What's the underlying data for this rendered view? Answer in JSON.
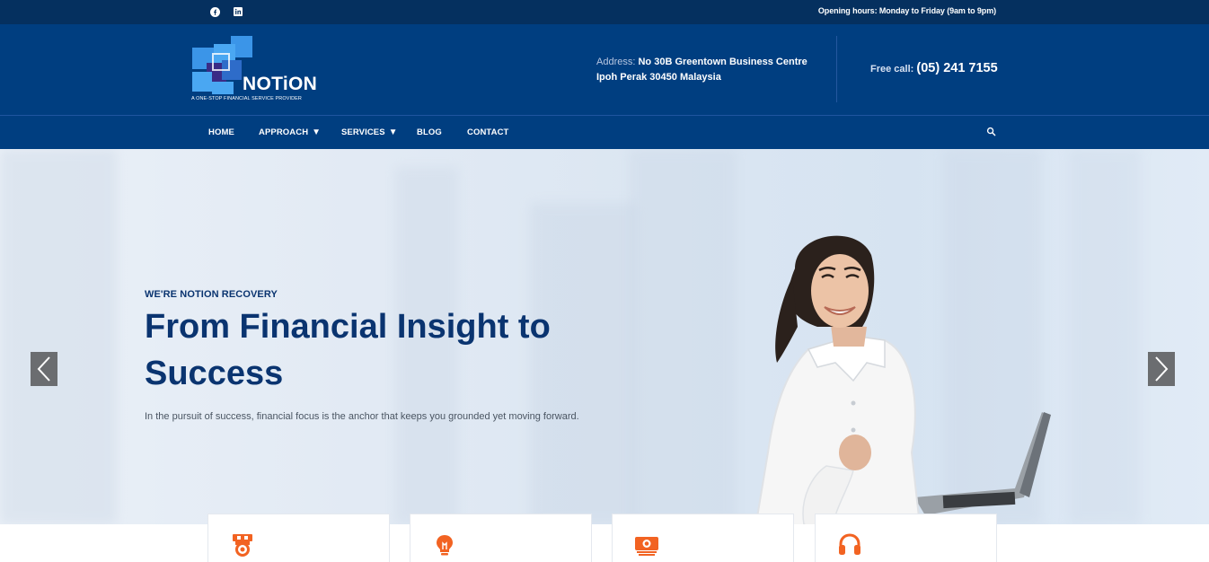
{
  "topbar": {
    "social": [
      {
        "name": "facebook-icon"
      },
      {
        "name": "linkedin-icon"
      }
    ],
    "hours": "Opening hours: Monday to Friday (9am to 9pm)"
  },
  "header": {
    "logo": {
      "word": "NOTiON",
      "tagline": "A ONE-STOP FINANCIAL SERVICE PROVIDER"
    },
    "address": {
      "label": "Address:",
      "line1": "No 30B Greentown Business Centre",
      "line2": "Ipoh Perak 30450 Malaysia"
    },
    "freecall": {
      "label": "Free call:",
      "number": "(05) 241 7155"
    }
  },
  "nav": {
    "items": [
      {
        "label": "HOME",
        "dropdown": false
      },
      {
        "label": "APPROACH",
        "dropdown": true
      },
      {
        "label": "SERVICES",
        "dropdown": true
      },
      {
        "label": "BLOG",
        "dropdown": false
      },
      {
        "label": "CONTACT",
        "dropdown": false
      }
    ],
    "caret": "▼",
    "search_icon": "search-icon"
  },
  "hero": {
    "eyebrow": "WE'RE NOTION RECOVERY",
    "headline": "From Financial Insight to Success",
    "subtext": "In the pursuit of success, financial focus is the anchor that keeps you grounded yet moving forward.",
    "prev_icon": "chevron-left-icon",
    "next_icon": "chevron-right-icon"
  },
  "cards": [
    {
      "icon": "medal-icon"
    },
    {
      "icon": "lightbulb-icon"
    },
    {
      "icon": "money-icon"
    },
    {
      "icon": "headset-icon"
    }
  ],
  "colors": {
    "topbar": "#05305f",
    "header": "#003e80",
    "headline": "#0a3470",
    "accent_orange": "#f26322",
    "arrow_bg": "#6b6d70"
  }
}
